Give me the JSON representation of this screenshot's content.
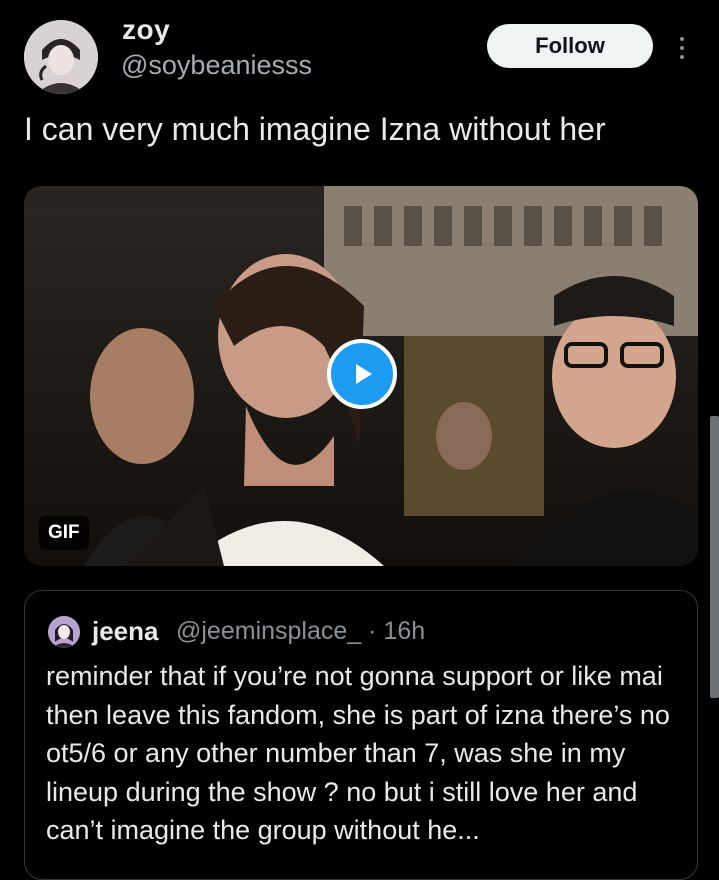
{
  "post": {
    "display_name": "zoy",
    "handle": "@soybeaniesss",
    "follow_label": "Follow",
    "text": "I can very much imagine Izna without her",
    "media": {
      "type": "gif",
      "badge": "GIF",
      "play_icon": "play-icon"
    }
  },
  "quote": {
    "display_name": "jeena",
    "handle_time": "@jeeminsplace_ · 16h",
    "text": "reminder that if you’re not gonna support or like mai then leave this fandom, she is part of izna there’s no ot5/6 or any other number than 7, was she in my lineup during the show ? no but i still love her and can’t imagine the group without he..."
  },
  "icons": {
    "more": "more-vertical-icon",
    "play": "play-icon"
  },
  "colors": {
    "background": "#000000",
    "text_primary": "#e7e9ea",
    "text_secondary": "#8b9096",
    "follow_bg": "#eff3f4",
    "accent": "#1d9bf0",
    "border": "#333639"
  }
}
